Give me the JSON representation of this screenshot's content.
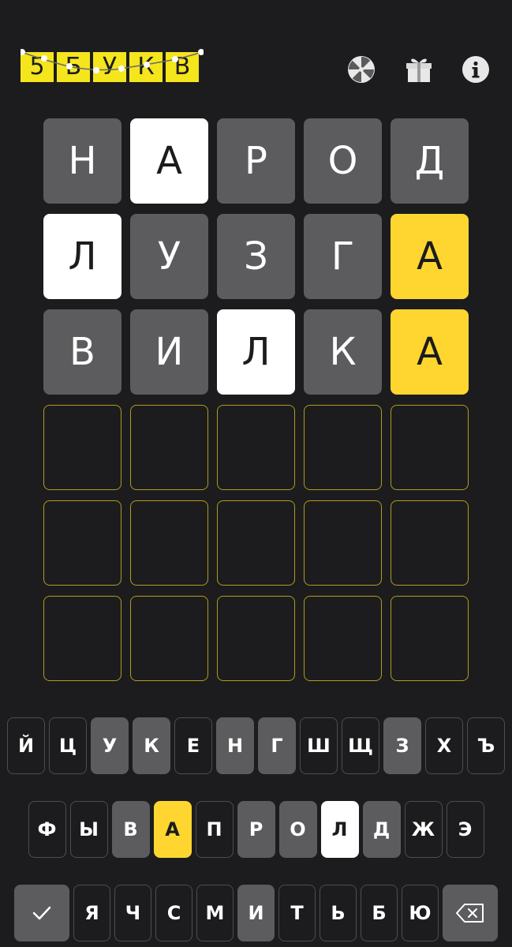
{
  "header": {
    "logo_letters": [
      "5",
      "Б",
      "У",
      "К",
      "В"
    ],
    "icons": [
      "wheel-icon",
      "gift-icon",
      "info-icon"
    ]
  },
  "colors": {
    "background": "#1c1c1e",
    "absent": "#5c5c5e",
    "present": "#ffffff",
    "correct": "#fed62f",
    "empty_border": "#b39a1a",
    "logo": "#f5e51c"
  },
  "board": {
    "rows": [
      [
        {
          "l": "Н",
          "s": "absent"
        },
        {
          "l": "А",
          "s": "present"
        },
        {
          "l": "Р",
          "s": "absent"
        },
        {
          "l": "О",
          "s": "absent"
        },
        {
          "l": "Д",
          "s": "absent"
        }
      ],
      [
        {
          "l": "Л",
          "s": "present"
        },
        {
          "l": "У",
          "s": "absent"
        },
        {
          "l": "З",
          "s": "absent"
        },
        {
          "l": "Г",
          "s": "absent"
        },
        {
          "l": "А",
          "s": "correct"
        }
      ],
      [
        {
          "l": "В",
          "s": "absent"
        },
        {
          "l": "И",
          "s": "absent"
        },
        {
          "l": "Л",
          "s": "present"
        },
        {
          "l": "К",
          "s": "absent"
        },
        {
          "l": "А",
          "s": "correct"
        }
      ],
      [
        {
          "l": "",
          "s": "empty"
        },
        {
          "l": "",
          "s": "empty"
        },
        {
          "l": "",
          "s": "empty"
        },
        {
          "l": "",
          "s": "empty"
        },
        {
          "l": "",
          "s": "empty"
        }
      ],
      [
        {
          "l": "",
          "s": "empty"
        },
        {
          "l": "",
          "s": "empty"
        },
        {
          "l": "",
          "s": "empty"
        },
        {
          "l": "",
          "s": "empty"
        },
        {
          "l": "",
          "s": "empty"
        }
      ],
      [
        {
          "l": "",
          "s": "empty"
        },
        {
          "l": "",
          "s": "empty"
        },
        {
          "l": "",
          "s": "empty"
        },
        {
          "l": "",
          "s": "empty"
        },
        {
          "l": "",
          "s": "empty"
        }
      ]
    ]
  },
  "keyboard": {
    "rows": [
      [
        {
          "k": "Й",
          "s": "unused"
        },
        {
          "k": "Ц",
          "s": "unused"
        },
        {
          "k": "У",
          "s": "absent"
        },
        {
          "k": "К",
          "s": "absent"
        },
        {
          "k": "Е",
          "s": "unused"
        },
        {
          "k": "Н",
          "s": "absent"
        },
        {
          "k": "Г",
          "s": "absent"
        },
        {
          "k": "Ш",
          "s": "unused"
        },
        {
          "k": "Щ",
          "s": "unused"
        },
        {
          "k": "З",
          "s": "absent"
        },
        {
          "k": "Х",
          "s": "unused"
        },
        {
          "k": "Ъ",
          "s": "unused"
        }
      ],
      [
        {
          "k": "Ф",
          "s": "unused"
        },
        {
          "k": "Ы",
          "s": "unused"
        },
        {
          "k": "В",
          "s": "absent"
        },
        {
          "k": "А",
          "s": "correct"
        },
        {
          "k": "П",
          "s": "unused"
        },
        {
          "k": "Р",
          "s": "absent"
        },
        {
          "k": "О",
          "s": "absent"
        },
        {
          "k": "Л",
          "s": "present"
        },
        {
          "k": "Д",
          "s": "absent"
        },
        {
          "k": "Ж",
          "s": "unused"
        },
        {
          "k": "Э",
          "s": "unused"
        }
      ],
      [
        {
          "k": "Я",
          "s": "unused"
        },
        {
          "k": "Ч",
          "s": "unused"
        },
        {
          "k": "С",
          "s": "unused"
        },
        {
          "k": "М",
          "s": "unused"
        },
        {
          "k": "И",
          "s": "absent"
        },
        {
          "k": "Т",
          "s": "unused"
        },
        {
          "k": "Ь",
          "s": "unused"
        },
        {
          "k": "Б",
          "s": "unused"
        },
        {
          "k": "Ю",
          "s": "unused"
        }
      ]
    ],
    "enter_icon": "checkmark-icon",
    "backspace_icon": "backspace-icon"
  }
}
